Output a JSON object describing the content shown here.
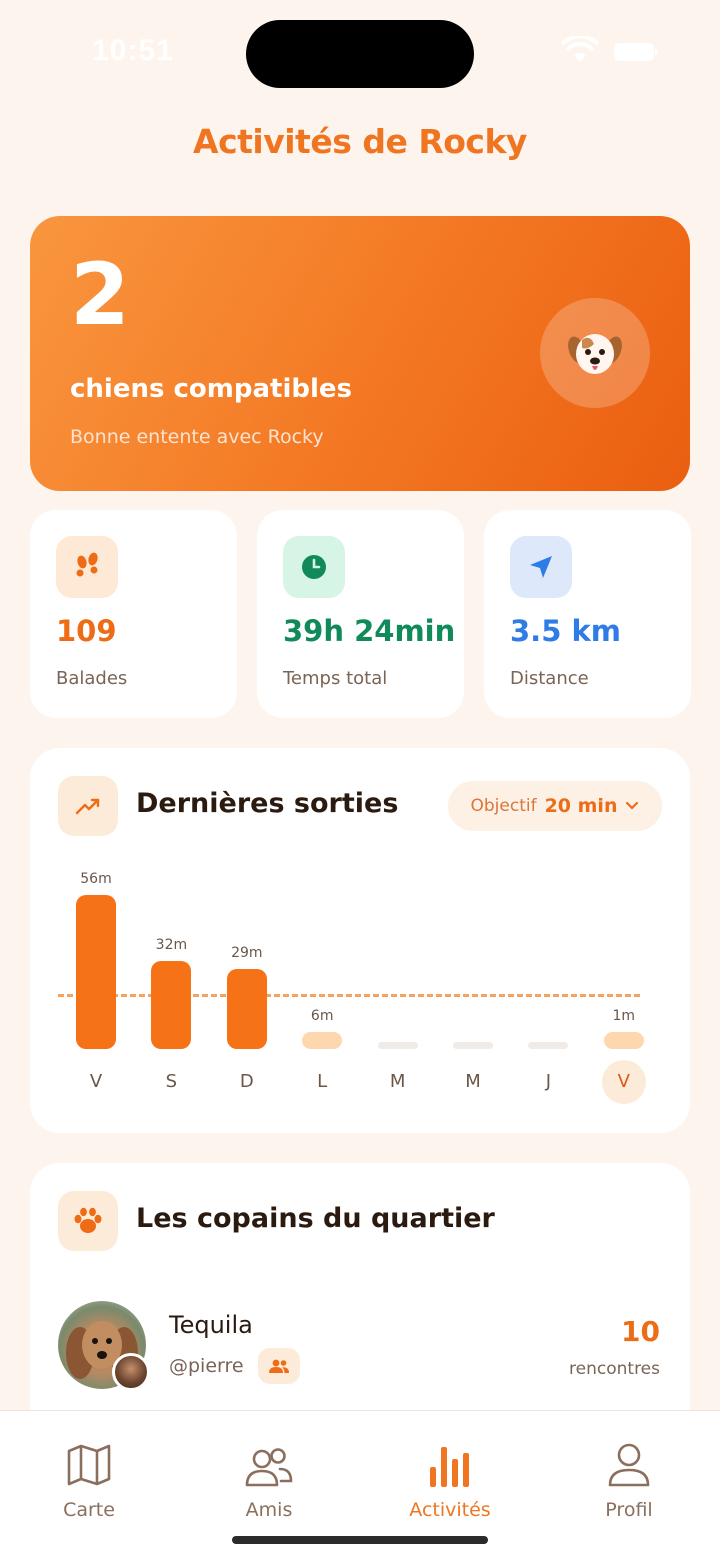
{
  "status_bar": {
    "time": "10:51"
  },
  "header": {
    "title": "Activités de Rocky"
  },
  "hero": {
    "count": "2",
    "label": "chiens compatibles",
    "subtitle": "Bonne entente avec Rocky",
    "badge_emoji": "🐶"
  },
  "stats": [
    {
      "icon": "paw-prints-icon",
      "value": "109",
      "label": "Balades",
      "color": "#ef6c17",
      "icon_bg": "#fde9d6"
    },
    {
      "icon": "clock-icon",
      "value": "39h 24min",
      "label": "Temps total",
      "color": "#0f8a58",
      "icon_bg": "#d6f5e6"
    },
    {
      "icon": "location-arrow-icon",
      "value": "3.5 km",
      "label": "Distance",
      "color": "#2e7ce6",
      "icon_bg": "#dde9fb"
    }
  ],
  "outings": {
    "title": "Dernières sorties",
    "goal_label": "Objectif",
    "goal_value": "20 min",
    "goal_minutes": 20,
    "bar_color": "#f57217",
    "low_bar_color": "#fdd7ae",
    "empty_bar_color": "#f0ebe7"
  },
  "chart_data": {
    "type": "bar",
    "categories": [
      "V",
      "S",
      "D",
      "L",
      "M",
      "M",
      "J",
      "V"
    ],
    "values": [
      56,
      32,
      29,
      6,
      0,
      0,
      0,
      1
    ],
    "value_labels": [
      "56m",
      "32m",
      "29m",
      "6m",
      "",
      "",
      "",
      "1m"
    ],
    "ylabel": "",
    "xlabel": "",
    "reference_line": 20,
    "highlight_index": 7
  },
  "friends": {
    "title": "Les copains du quartier",
    "items": [
      {
        "name": "Tequila",
        "handle": "@pierre",
        "meet_count": "10",
        "meet_label": "rencontres"
      }
    ]
  },
  "tabbar": {
    "items": [
      {
        "label": "Carte",
        "icon": "map-icon",
        "active": false
      },
      {
        "label": "Amis",
        "icon": "friends-icon",
        "active": false
      },
      {
        "label": "Activités",
        "icon": "bar-chart-icon",
        "active": true
      },
      {
        "label": "Profil",
        "icon": "person-icon",
        "active": false
      }
    ]
  }
}
